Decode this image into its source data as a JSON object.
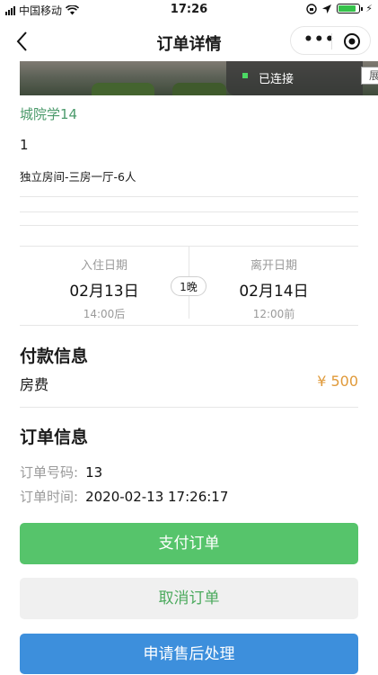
{
  "status_bar": {
    "carrier": "中国移动",
    "time": "17:26",
    "battery_level": 0.9
  },
  "nav": {
    "title": "订单详情"
  },
  "banner": {
    "connection_status": "已连接",
    "expand_label": "展"
  },
  "room": {
    "school": "城院学14",
    "number": "1",
    "type": "独立房间-三房一厅-6人"
  },
  "stay": {
    "checkin_label": "入住日期",
    "checkin_date": "02月13日",
    "checkin_time": "14:00后",
    "nights": "1晚",
    "checkout_label": "离开日期",
    "checkout_date": "02月14日",
    "checkout_time": "12:00前"
  },
  "payment": {
    "title": "付款信息",
    "fee_label": "房费",
    "fee_value": "¥ 500"
  },
  "order": {
    "title": "订单信息",
    "number_label": "订单号码:",
    "number_value": "13",
    "time_label": "订单时间:",
    "time_value": "2020-02-13 17:26:17"
  },
  "actions": {
    "pay": "支付订单",
    "cancel": "取消订单",
    "after_sales": "申请售后处理"
  },
  "colors": {
    "primary_green": "#56c46b",
    "accent_blue": "#3d8fdc",
    "price_orange": "#e09a3a",
    "school_green": "#4b9a6b"
  }
}
